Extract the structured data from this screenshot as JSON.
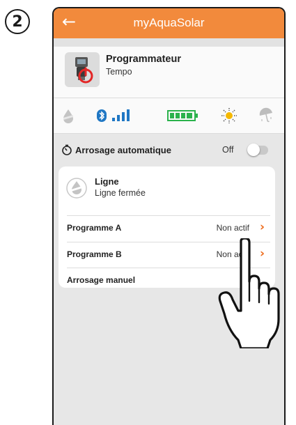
{
  "step": {
    "number": "2"
  },
  "app": {
    "title": "myAquaSolar"
  },
  "device": {
    "name": "Programmateur",
    "model": "Tempo"
  },
  "status_icons": [
    "rain-drop-icon",
    "bluetooth-icon",
    "signal-icon",
    "battery-icon",
    "sun-icon",
    "umbrella-icon"
  ],
  "auto_watering": {
    "label": "Arrosage automatique",
    "value": "Off",
    "enabled": false
  },
  "line": {
    "title": "Ligne",
    "status": "Ligne fermée"
  },
  "rows": [
    {
      "label": "Programme A",
      "value": "Non actif"
    },
    {
      "label": "Programme B",
      "value": "Non actif"
    },
    {
      "label": "Arrosage manuel",
      "value": ""
    }
  ],
  "colors": {
    "accent": "#f28a3c",
    "chevron": "#ee6d1e",
    "battery": "#2bb24c",
    "bluetooth": "#1f77c4",
    "sun": "#f5b800"
  }
}
